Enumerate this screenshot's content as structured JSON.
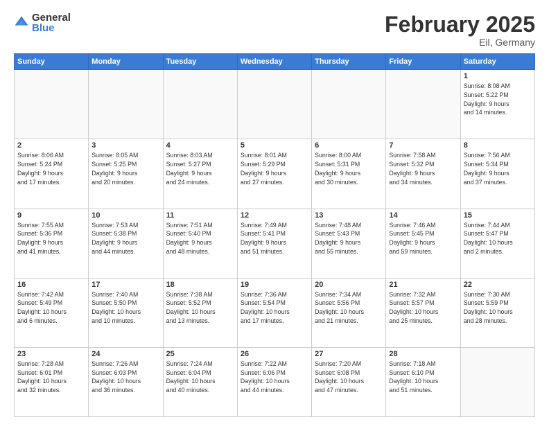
{
  "header": {
    "logo_general": "General",
    "logo_blue": "Blue",
    "month_title": "February 2025",
    "location": "Eil, Germany"
  },
  "weekdays": [
    "Sunday",
    "Monday",
    "Tuesday",
    "Wednesday",
    "Thursday",
    "Friday",
    "Saturday"
  ],
  "weeks": [
    [
      {
        "day": "",
        "info": ""
      },
      {
        "day": "",
        "info": ""
      },
      {
        "day": "",
        "info": ""
      },
      {
        "day": "",
        "info": ""
      },
      {
        "day": "",
        "info": ""
      },
      {
        "day": "",
        "info": ""
      },
      {
        "day": "1",
        "info": "Sunrise: 8:08 AM\nSunset: 5:22 PM\nDaylight: 9 hours\nand 14 minutes."
      }
    ],
    [
      {
        "day": "2",
        "info": "Sunrise: 8:06 AM\nSunset: 5:24 PM\nDaylight: 9 hours\nand 17 minutes."
      },
      {
        "day": "3",
        "info": "Sunrise: 8:05 AM\nSunset: 5:25 PM\nDaylight: 9 hours\nand 20 minutes."
      },
      {
        "day": "4",
        "info": "Sunrise: 8:03 AM\nSunset: 5:27 PM\nDaylight: 9 hours\nand 24 minutes."
      },
      {
        "day": "5",
        "info": "Sunrise: 8:01 AM\nSunset: 5:29 PM\nDaylight: 9 hours\nand 27 minutes."
      },
      {
        "day": "6",
        "info": "Sunrise: 8:00 AM\nSunset: 5:31 PM\nDaylight: 9 hours\nand 30 minutes."
      },
      {
        "day": "7",
        "info": "Sunrise: 7:58 AM\nSunset: 5:32 PM\nDaylight: 9 hours\nand 34 minutes."
      },
      {
        "day": "8",
        "info": "Sunrise: 7:56 AM\nSunset: 5:34 PM\nDaylight: 9 hours\nand 37 minutes."
      }
    ],
    [
      {
        "day": "9",
        "info": "Sunrise: 7:55 AM\nSunset: 5:36 PM\nDaylight: 9 hours\nand 41 minutes."
      },
      {
        "day": "10",
        "info": "Sunrise: 7:53 AM\nSunset: 5:38 PM\nDaylight: 9 hours\nand 44 minutes."
      },
      {
        "day": "11",
        "info": "Sunrise: 7:51 AM\nSunset: 5:40 PM\nDaylight: 9 hours\nand 48 minutes."
      },
      {
        "day": "12",
        "info": "Sunrise: 7:49 AM\nSunset: 5:41 PM\nDaylight: 9 hours\nand 51 minutes."
      },
      {
        "day": "13",
        "info": "Sunrise: 7:48 AM\nSunset: 5:43 PM\nDaylight: 9 hours\nand 55 minutes."
      },
      {
        "day": "14",
        "info": "Sunrise: 7:46 AM\nSunset: 5:45 PM\nDaylight: 9 hours\nand 59 minutes."
      },
      {
        "day": "15",
        "info": "Sunrise: 7:44 AM\nSunset: 5:47 PM\nDaylight: 10 hours\nand 2 minutes."
      }
    ],
    [
      {
        "day": "16",
        "info": "Sunrise: 7:42 AM\nSunset: 5:49 PM\nDaylight: 10 hours\nand 6 minutes."
      },
      {
        "day": "17",
        "info": "Sunrise: 7:40 AM\nSunset: 5:50 PM\nDaylight: 10 hours\nand 10 minutes."
      },
      {
        "day": "18",
        "info": "Sunrise: 7:38 AM\nSunset: 5:52 PM\nDaylight: 10 hours\nand 13 minutes."
      },
      {
        "day": "19",
        "info": "Sunrise: 7:36 AM\nSunset: 5:54 PM\nDaylight: 10 hours\nand 17 minutes."
      },
      {
        "day": "20",
        "info": "Sunrise: 7:34 AM\nSunset: 5:56 PM\nDaylight: 10 hours\nand 21 minutes."
      },
      {
        "day": "21",
        "info": "Sunrise: 7:32 AM\nSunset: 5:57 PM\nDaylight: 10 hours\nand 25 minutes."
      },
      {
        "day": "22",
        "info": "Sunrise: 7:30 AM\nSunset: 5:59 PM\nDaylight: 10 hours\nand 28 minutes."
      }
    ],
    [
      {
        "day": "23",
        "info": "Sunrise: 7:28 AM\nSunset: 6:01 PM\nDaylight: 10 hours\nand 32 minutes."
      },
      {
        "day": "24",
        "info": "Sunrise: 7:26 AM\nSunset: 6:03 PM\nDaylight: 10 hours\nand 36 minutes."
      },
      {
        "day": "25",
        "info": "Sunrise: 7:24 AM\nSunset: 6:04 PM\nDaylight: 10 hours\nand 40 minutes."
      },
      {
        "day": "26",
        "info": "Sunrise: 7:22 AM\nSunset: 6:06 PM\nDaylight: 10 hours\nand 44 minutes."
      },
      {
        "day": "27",
        "info": "Sunrise: 7:20 AM\nSunset: 6:08 PM\nDaylight: 10 hours\nand 47 minutes."
      },
      {
        "day": "28",
        "info": "Sunrise: 7:18 AM\nSunset: 6:10 PM\nDaylight: 10 hours\nand 51 minutes."
      },
      {
        "day": "",
        "info": ""
      }
    ]
  ]
}
